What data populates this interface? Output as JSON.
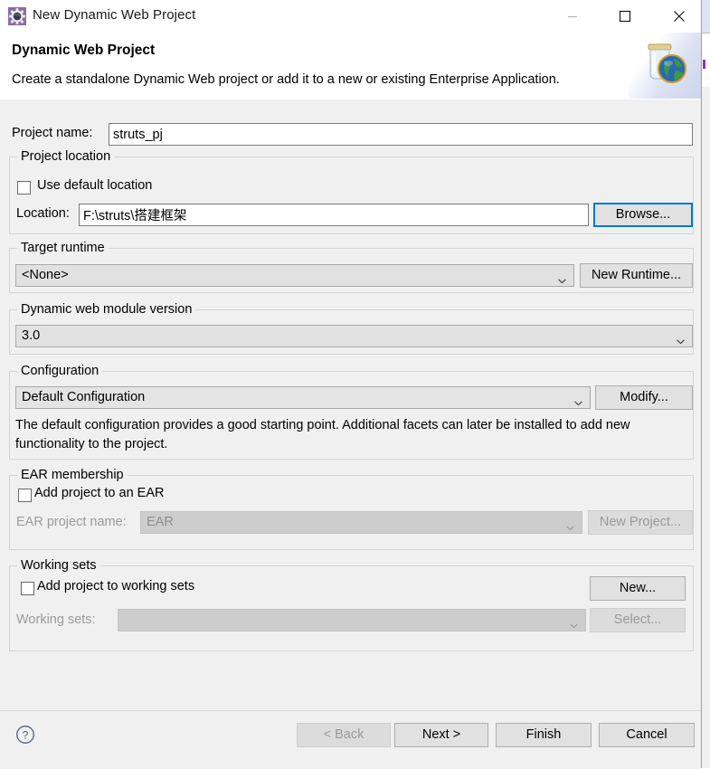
{
  "window": {
    "title": "New Dynamic Web Project",
    "icon": "eclipse-gear-icon",
    "minimize_label": "Minimize",
    "maximize_label": "Maximize",
    "close_label": "Close"
  },
  "banner": {
    "title": "Dynamic Web Project",
    "description": "Create a standalone Dynamic Web project or add it to a new or existing Enterprise Application.",
    "icon": "jar-globe-icon"
  },
  "project_name": {
    "label": "Project name:",
    "value": "struts_pj"
  },
  "project_location": {
    "group_title": "Project location",
    "use_default_label": "Use default location",
    "use_default_checked": false,
    "location_label": "Location:",
    "location_value": "F:\\struts\\搭建框架",
    "browse_label": "Browse..."
  },
  "target_runtime": {
    "group_title": "Target runtime",
    "value": "<None>",
    "new_runtime_label": "New Runtime..."
  },
  "module_version": {
    "group_title": "Dynamic web module version",
    "value": "3.0"
  },
  "configuration": {
    "group_title": "Configuration",
    "value": "Default Configuration",
    "modify_label": "Modify...",
    "description": "The default configuration provides a good starting point. Additional facets can later be installed to add new functionality to the project."
  },
  "ear_membership": {
    "group_title": "EAR membership",
    "add_to_ear_label": "Add project to an EAR",
    "add_to_ear_checked": false,
    "ear_project_name_label": "EAR project name:",
    "ear_project_name_value": "EAR",
    "new_project_label": "New Project..."
  },
  "working_sets": {
    "group_title": "Working sets",
    "add_to_working_sets_label": "Add project to working sets",
    "add_to_working_sets_checked": false,
    "new_label": "New...",
    "working_sets_label": "Working sets:",
    "working_sets_value": ""
  },
  "footer": {
    "help_icon": "help-circle-icon",
    "back_label": "< Back",
    "next_label": "Next >",
    "finish_label": "Finish",
    "cancel_label": "Cancel"
  },
  "colors": {
    "dialog_bg": "#f0f0f0",
    "focus_blue": "#0078d7",
    "title_icon_purple": "#7d5aa0",
    "disabled_text": "#9a9a9a"
  }
}
